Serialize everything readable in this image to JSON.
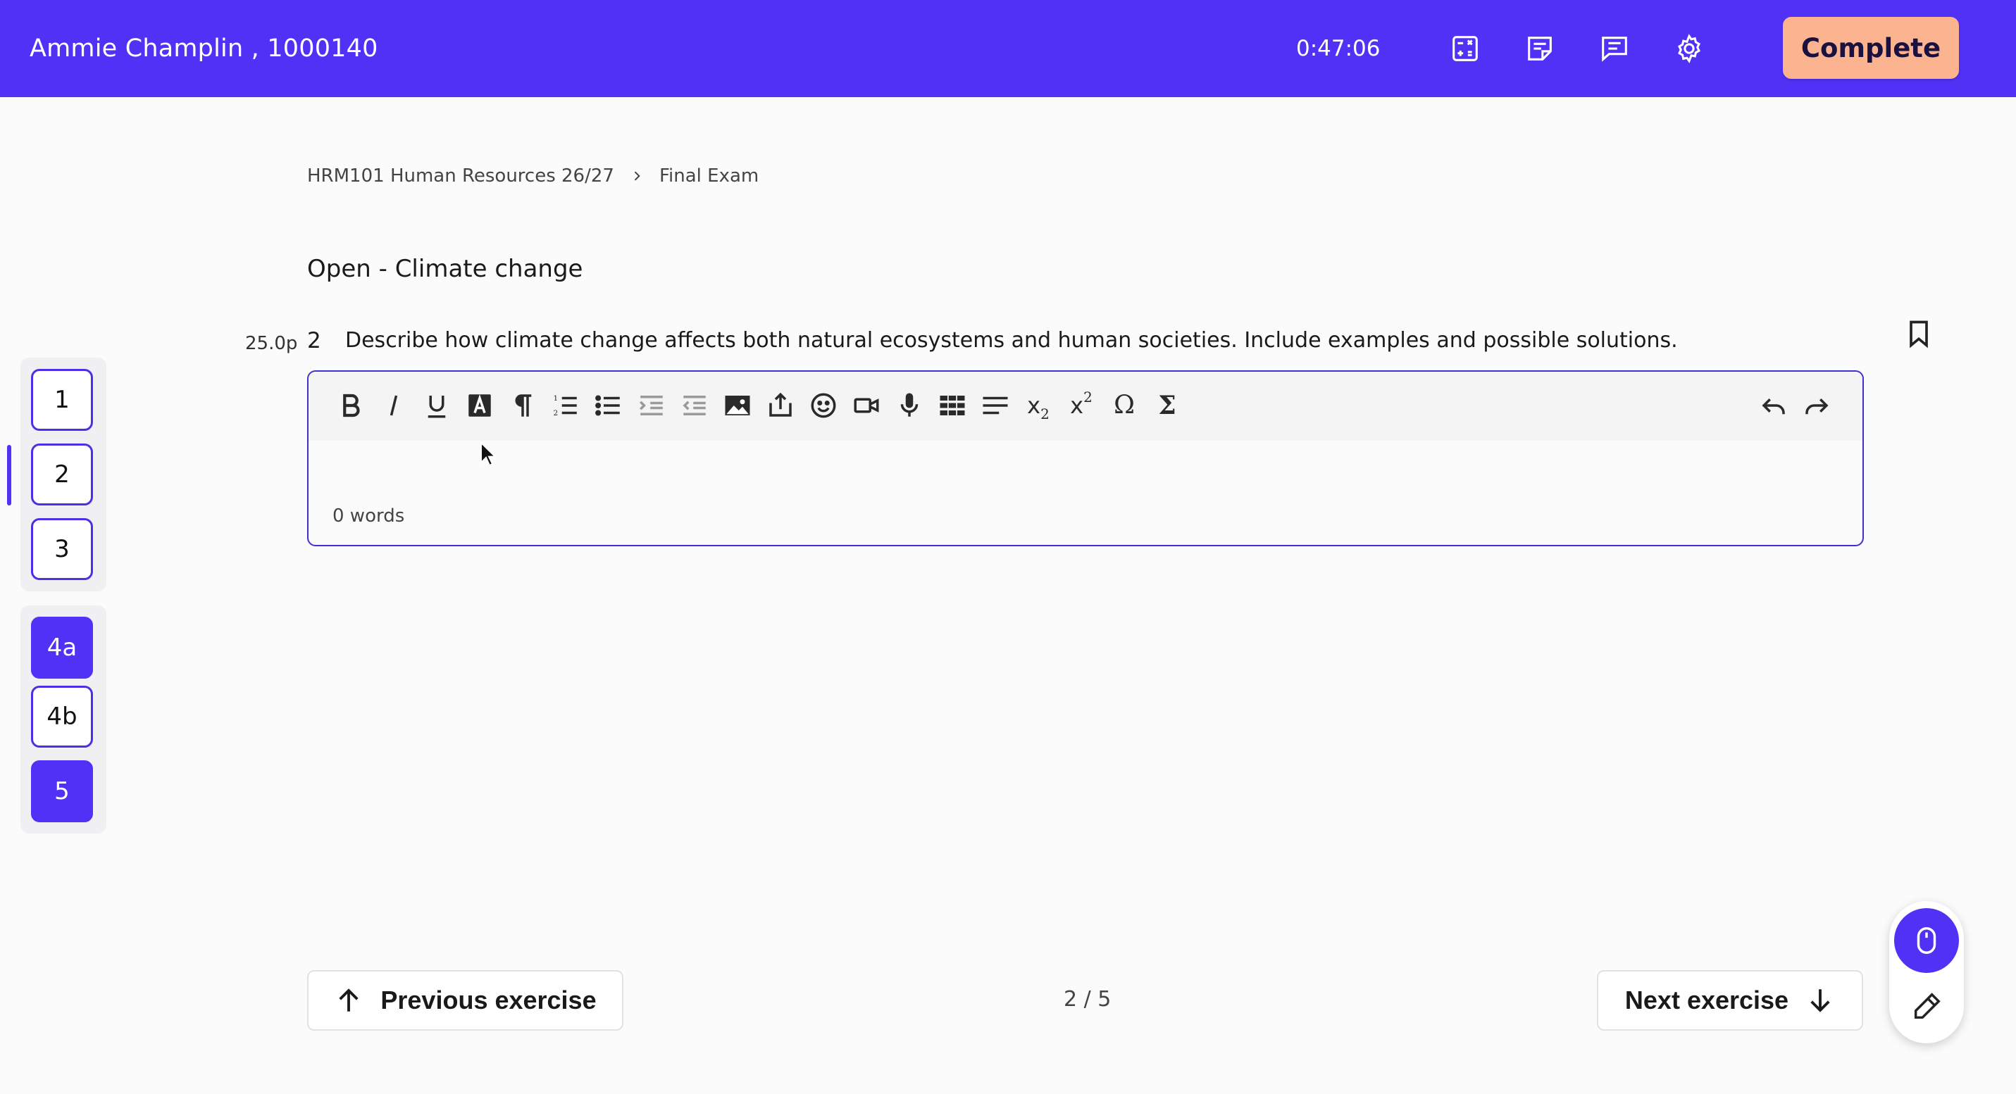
{
  "header": {
    "user": "Ammie Champlin , 1000140",
    "timer": "0:47:06",
    "icons": [
      "calculator-icon",
      "notes-icon",
      "chat-icon",
      "gear-icon"
    ],
    "complete_label": "Complete",
    "colors": {
      "bar": "#5131f6",
      "complete": "#fbb48f"
    }
  },
  "breadcrumb": {
    "course": "HRM101 Human Resources 26/27",
    "exam": "Final Exam"
  },
  "section": {
    "title": "Open - Climate change"
  },
  "question": {
    "points": "25.0p",
    "number": "2",
    "text": "Describe how climate change affects both natural ecosystems and human societies. Include examples and possible solutions."
  },
  "editor": {
    "toolbar": {
      "subscript": "x",
      "subscript_sub": "2",
      "superscript": "x",
      "superscript_sup": "2",
      "omega": "Ω",
      "sigma": "Σ"
    },
    "word_count": "0 words"
  },
  "nav": {
    "group1": [
      "1",
      "2",
      "3"
    ],
    "group2": [
      "4a",
      "4b",
      "5"
    ],
    "active": "2"
  },
  "footer": {
    "prev_label": "Previous exercise",
    "next_label": "Next exercise",
    "page_indicator": "2 / 5"
  }
}
